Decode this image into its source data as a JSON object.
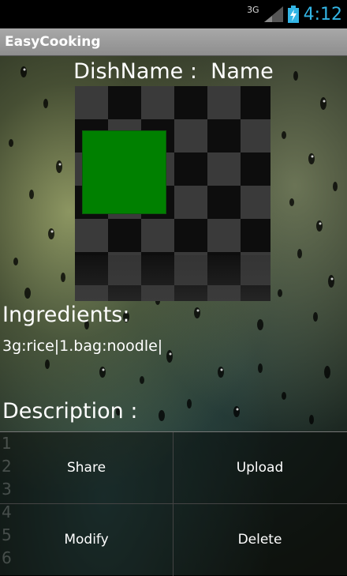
{
  "status_bar": {
    "network": "3G",
    "time": "4:12",
    "icons": [
      "signal-icon",
      "battery-charging-icon"
    ]
  },
  "app": {
    "title": "EasyCooking"
  },
  "dish": {
    "name_label": "DishName :  Name",
    "image_placeholder": "green-square",
    "ingredients_label": "Ingredients:",
    "ingredients_value": "3g:rice|1.bag:noodle|",
    "description_label": "Description :"
  },
  "menu": {
    "share": "Share",
    "upload": "Upload",
    "modify": "Modify",
    "delete": "Delete"
  },
  "background_numbers": [
    "1",
    "2",
    "3",
    "4",
    "5",
    "6"
  ],
  "colors": {
    "clock": "#33b5e5",
    "titlebar": "#9a9a9a",
    "image_square": "#008000"
  }
}
